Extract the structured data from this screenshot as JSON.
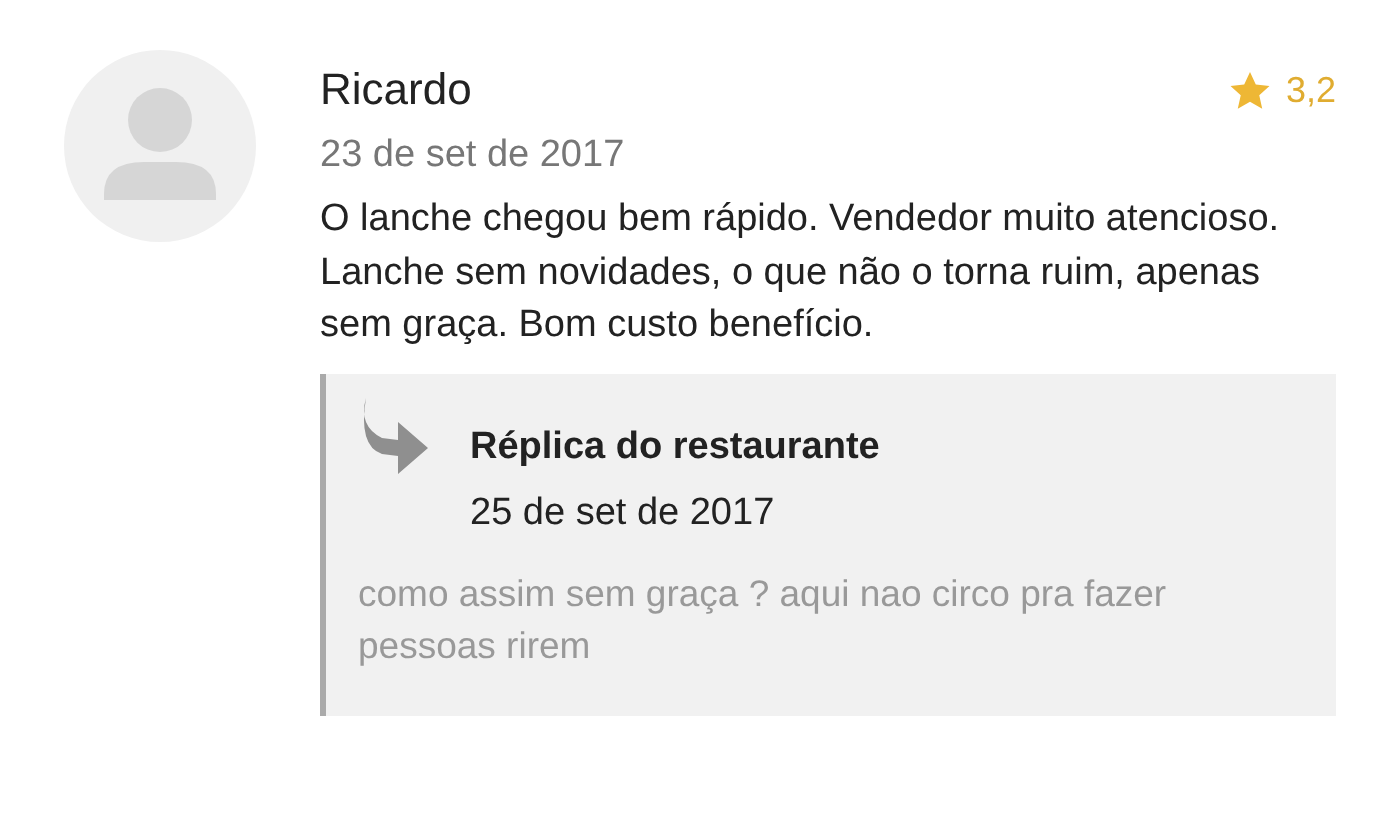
{
  "review": {
    "author": "Ricardo",
    "date": "23 de set de 2017",
    "rating": "3,2",
    "text": "O lanche chegou bem rápido. Vendedor muito atencioso. Lanche sem novidades, o que não o torna ruim, apenas sem graça. Bom custo benefício."
  },
  "reply": {
    "title": "Réplica do restaurante",
    "date": "25 de set de 2017",
    "text": "como assim sem graça ? aqui nao circo pra fazer pessoas rirem"
  }
}
